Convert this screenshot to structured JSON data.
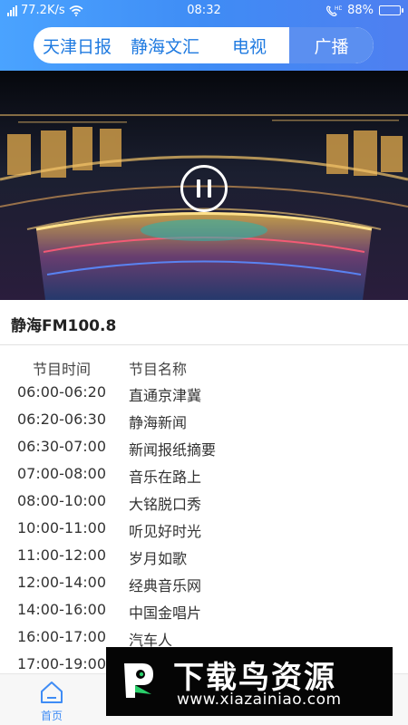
{
  "status_bar": {
    "speed": "77.2K/s",
    "time": "08:32",
    "battery": "88%",
    "battery_level": 0.88,
    "icons": [
      "signal-icon",
      "wifi-icon",
      "phone-hd-icon",
      "battery-icon"
    ]
  },
  "top_tabs": [
    {
      "label": "天津日报",
      "active": false
    },
    {
      "label": "静海文汇",
      "active": false
    },
    {
      "label": "电视",
      "active": false
    },
    {
      "label": "广播",
      "active": true
    }
  ],
  "player": {
    "state": "playing",
    "control_icon": "pause-icon"
  },
  "station_name": "静海FM100.8",
  "schedule": {
    "header_time": "节目时间",
    "header_name": "节目名称",
    "rows": [
      {
        "time": "06:00-06:20",
        "name": "直通京津冀"
      },
      {
        "time": "06:20-06:30",
        "name": "静海新闻"
      },
      {
        "time": "06:30-07:00",
        "name": "新闻报纸摘要"
      },
      {
        "time": "07:00-08:00",
        "name": "音乐在路上"
      },
      {
        "time": "08:00-10:00",
        "name": "大铭脱口秀"
      },
      {
        "time": "10:00-11:00",
        "name": "听见好时光"
      },
      {
        "time": "11:00-12:00",
        "name": "岁月如歌"
      },
      {
        "time": "12:00-14:00",
        "name": "经典音乐网"
      },
      {
        "time": "14:00-16:00",
        "name": "中国金唱片"
      },
      {
        "time": "16:00-17:00",
        "name": "汽车人"
      },
      {
        "time": "17:00-19:00",
        "name": ""
      }
    ]
  },
  "bottom_nav": {
    "home": "首页",
    "active_color": "#3f8cf5"
  },
  "watermark": {
    "title": "下载鸟资源",
    "url": "www.xiazainiao.com"
  },
  "colors": {
    "header_start": "#4aa3ff",
    "header_end": "#4f7ff0",
    "tab_text": "#1f7ae0",
    "active_tab_bg": "#5b8ff0"
  }
}
